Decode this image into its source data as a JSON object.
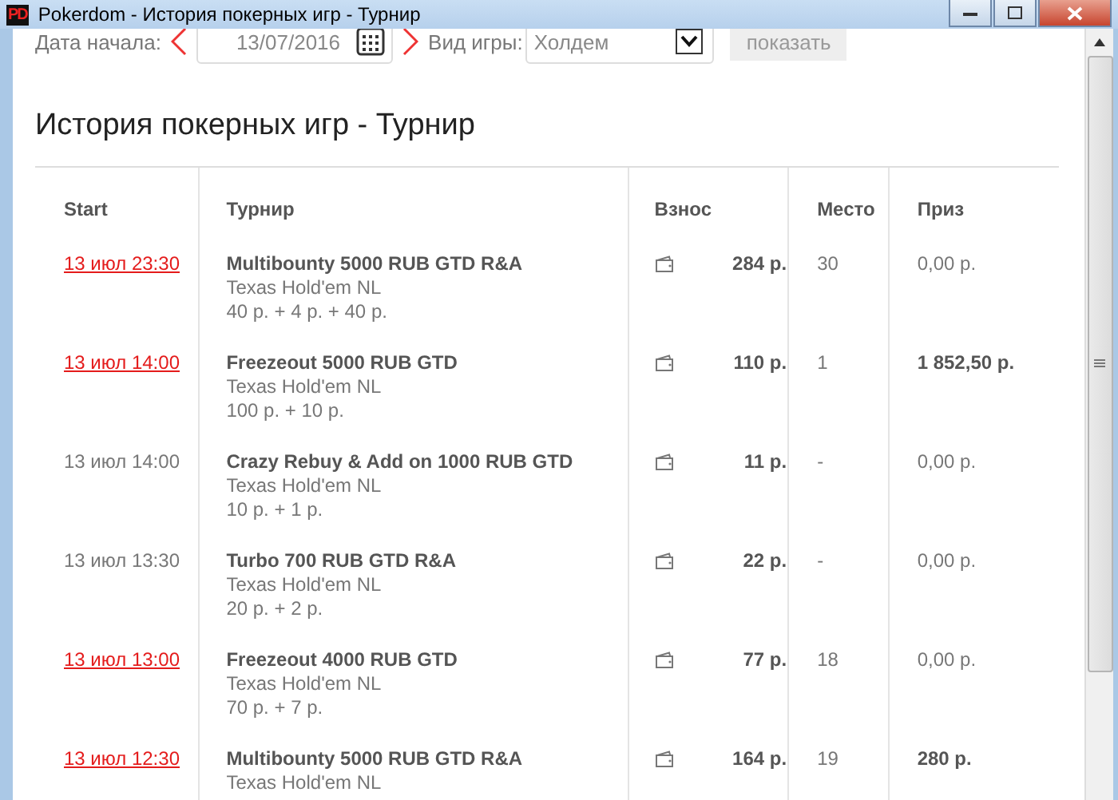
{
  "window": {
    "title": "Pokerdom - История покерных игр - Турнир",
    "logo": "PD"
  },
  "filter": {
    "date_label": "Дата начала:",
    "date_value": "13/07/2016",
    "game_label": "Вид игры:",
    "game_value": "Холдем",
    "show_button": "показать",
    "show_disabled": true
  },
  "heading": "История покерных игр - Турнир",
  "table": {
    "columns": [
      "Start",
      "Турнир",
      "Взнос",
      "Место",
      "Приз"
    ],
    "rows": [
      {
        "start": "13 июл 23:30",
        "link": true,
        "name": "Multibounty 5000 RUB GTD R&A",
        "lines": [
          "Texas Hold'em NL",
          "40 р. + 4 р. + 40 р."
        ],
        "fee": "284 р.",
        "place": "30",
        "prize": "0,00 р.",
        "won": false
      },
      {
        "start": "13 июл 14:00",
        "link": true,
        "name": "Freezeout 5000 RUB GTD",
        "lines": [
          "Texas Hold'em NL",
          "100 р. + 10 р."
        ],
        "fee": "110 р.",
        "place": "1",
        "prize": "1 852,50 р.",
        "won": true
      },
      {
        "start": "13 июл 14:00",
        "link": false,
        "name": "Crazy Rebuy & Add on 1000 RUB GTD",
        "lines": [
          "Texas Hold'em NL",
          "10 р. + 1 р."
        ],
        "fee": "11 р.",
        "place": "-",
        "prize": "0,00 р.",
        "won": false
      },
      {
        "start": "13 июл 13:30",
        "link": false,
        "name": "Turbo 700 RUB GTD R&A",
        "lines": [
          "Texas Hold'em NL",
          "20 р. + 2 р."
        ],
        "fee": "22 р.",
        "place": "-",
        "prize": "0,00 р.",
        "won": false
      },
      {
        "start": "13 июл 13:00",
        "link": true,
        "name": "Freezeout 4000 RUB GTD",
        "lines": [
          "Texas Hold'em NL",
          "70 р. + 7 р."
        ],
        "fee": "77 р.",
        "place": "18",
        "prize": "0,00 р.",
        "won": false
      },
      {
        "start": "13 июл 12:30",
        "link": true,
        "name": "Multibounty 5000 RUB GTD R&A",
        "lines": [
          "Texas Hold'em NL"
        ],
        "fee": "164 р.",
        "place": "19",
        "prize": "280 р.",
        "won": true
      }
    ]
  }
}
